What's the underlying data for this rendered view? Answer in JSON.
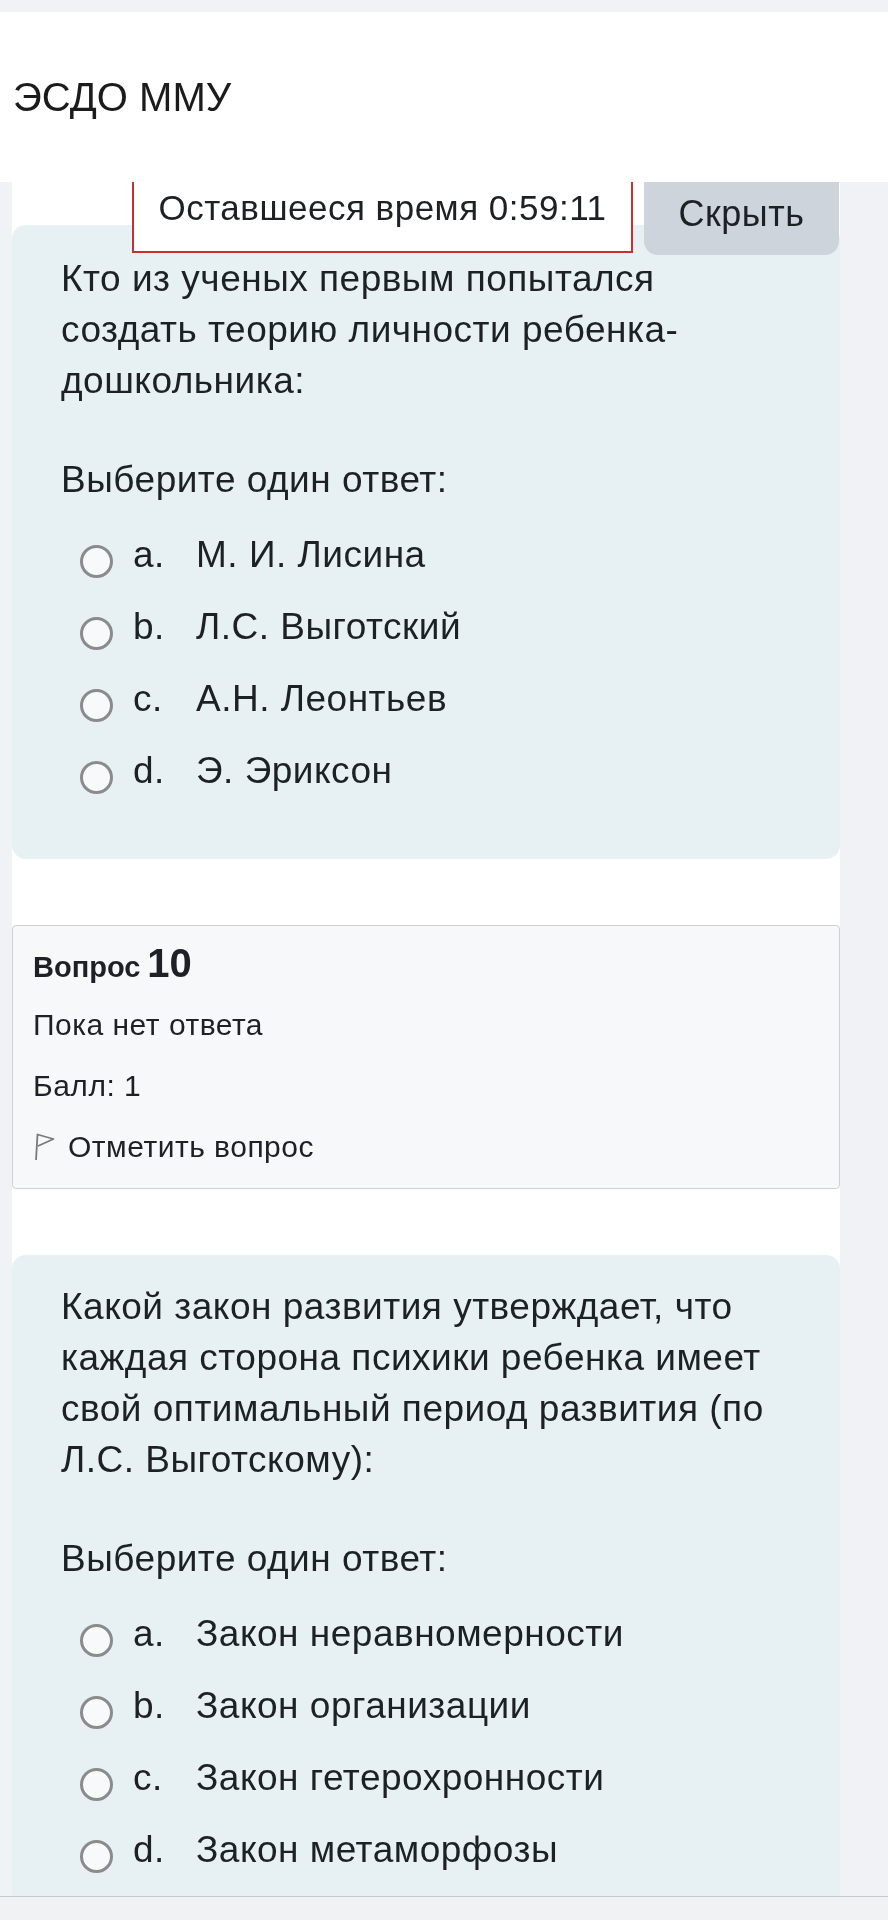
{
  "header": {
    "title": "ЭСДО ММУ"
  },
  "timer": {
    "text": "Оставшееся время 0:59:11"
  },
  "hide_button": {
    "label": "Скрыть"
  },
  "blocks": [
    {
      "kind": "question",
      "text": "Кто из ученых первым попытался создать теорию личности ребенка-дошкольника:",
      "prompt": "Выберите один ответ:",
      "options": [
        {
          "letter": "a.",
          "text": "М. И. Лисина",
          "selected": false
        },
        {
          "letter": "b.",
          "text": "Л.С. Выготский",
          "selected": false
        },
        {
          "letter": "c.",
          "text": "А.Н. Леонтьев",
          "selected": false
        },
        {
          "letter": "d.",
          "text": "Э. Эриксон",
          "selected": false
        }
      ]
    },
    {
      "kind": "info",
      "label": "Вопрос",
      "number": "10",
      "status": "Пока нет ответа",
      "score": "Балл: 1",
      "flag_label": "Отметить вопрос",
      "flagged": false
    },
    {
      "kind": "question",
      "text": "Какой закон развития утверждает, что каждая сторона психики ребенка имеет свой оптимальный период развития (по Л.С. Выготскому):",
      "prompt": "Выберите один ответ:",
      "options": [
        {
          "letter": "a.",
          "text": "Закон неравномерности",
          "selected": false
        },
        {
          "letter": "b.",
          "text": "Закон организации",
          "selected": false
        },
        {
          "letter": "c.",
          "text": "Закон гетерохронности",
          "selected": false
        },
        {
          "letter": "d.",
          "text": "Закон метаморфозы",
          "selected": false
        }
      ]
    }
  ]
}
